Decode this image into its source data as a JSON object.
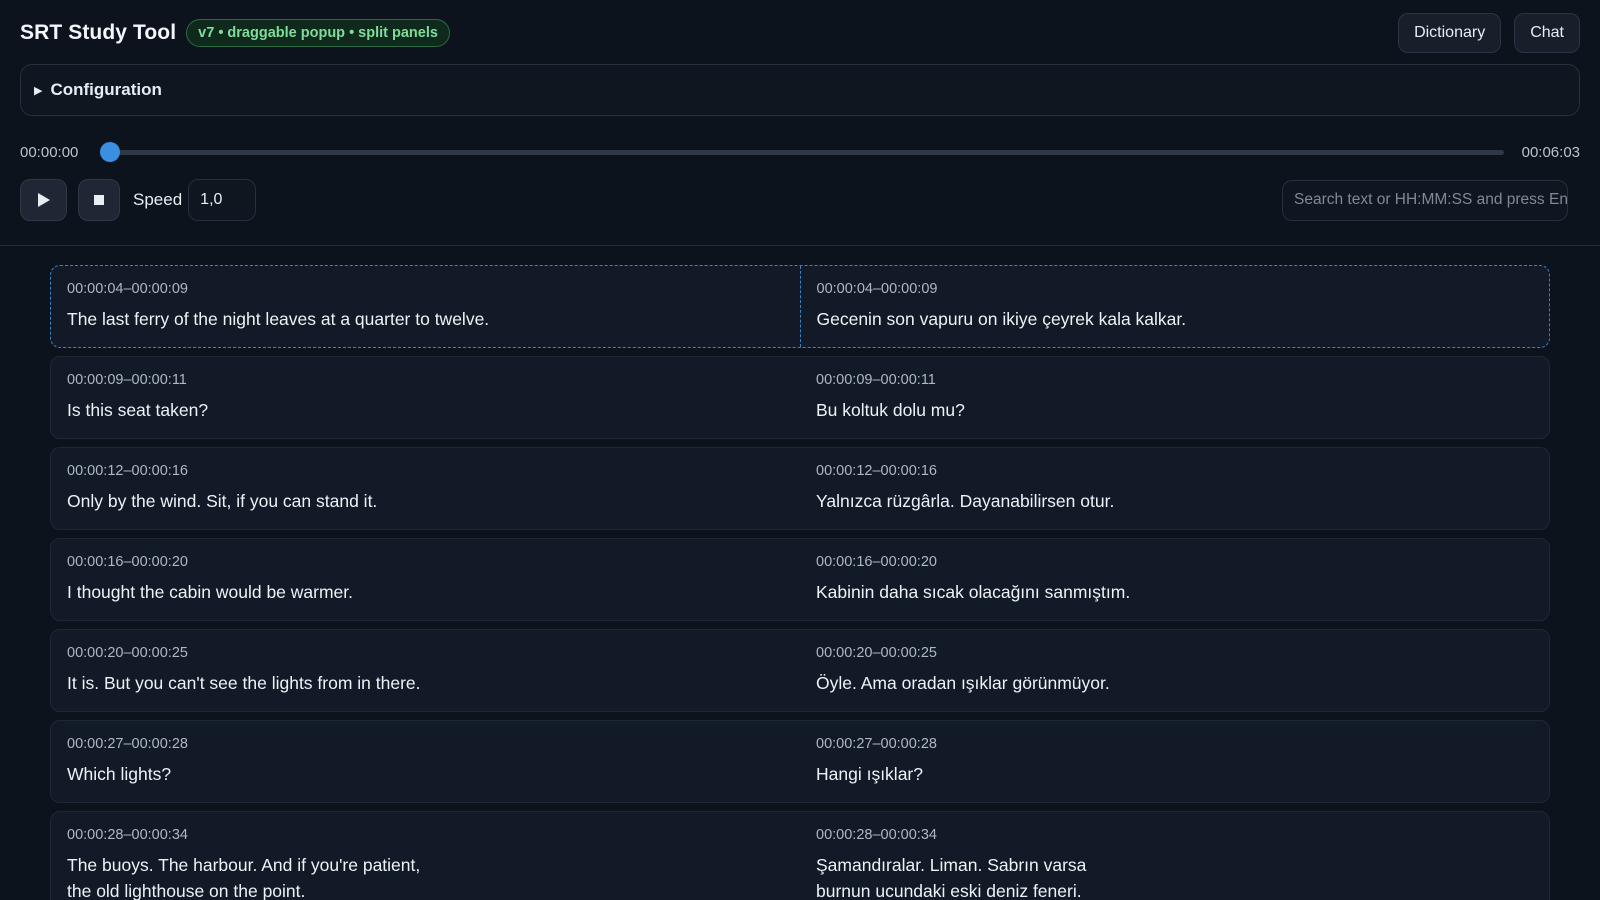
{
  "header": {
    "title": "SRT Study Tool",
    "badge": "v7 • draggable popup • split panels",
    "dictionary_label": "Dictionary",
    "chat_label": "Chat"
  },
  "config": {
    "label": "Configuration",
    "expanded": false
  },
  "timeline": {
    "current": "00:00:00",
    "total": "00:06:03",
    "progress": 0
  },
  "controls": {
    "play_icon": "play-icon",
    "stop_icon": "stop-icon",
    "speed_label": "Speed",
    "speed_value": "1,0",
    "search_placeholder": "Search text or HH:MM:SS and press Enter"
  },
  "colors": {
    "accent": "#3a8fe0",
    "background": "#0d131c",
    "badge_text": "#7fdc9a"
  },
  "cues": [
    {
      "left_time": "00:00:04–00:00:09",
      "left_text": "The last ferry of the night leaves at a quarter to twelve.",
      "right_time": "00:00:04–00:00:09",
      "right_text": "Gecenin son vapuru on ikiye çeyrek kala kalkar."
    },
    {
      "left_time": "00:00:09–00:00:11",
      "left_text": "Is this seat taken?",
      "right_time": "00:00:09–00:00:11",
      "right_text": "Bu koltuk dolu mu?"
    },
    {
      "left_time": "00:00:12–00:00:16",
      "left_text": "Only by the wind. Sit, if you can stand it.",
      "right_time": "00:00:12–00:00:16",
      "right_text": "Yalnızca rüzgârla. Dayanabilirsen otur."
    },
    {
      "left_time": "00:00:16–00:00:20",
      "left_text": "I thought the cabin would be warmer.",
      "right_time": "00:00:16–00:00:20",
      "right_text": "Kabinin daha sıcak olacağını sanmıştım."
    },
    {
      "left_time": "00:00:20–00:00:25",
      "left_text": "It is. But you can't see the lights from in there.",
      "right_time": "00:00:20–00:00:25",
      "right_text": "Öyle. Ama oradan ışıklar görünmüyor."
    },
    {
      "left_time": "00:00:27–00:00:28",
      "left_text": "Which lights?",
      "right_time": "00:00:27–00:00:28",
      "right_text": "Hangi ışıklar?"
    },
    {
      "left_time": "00:00:28–00:00:34",
      "left_text": "The buoys. The harbour. And if you're patient,\nthe old lighthouse on the point.",
      "right_time": "00:00:28–00:00:34",
      "right_text": "Şamandıralar. Liman. Sabrın varsa\nburnun ucundaki eski deniz feneri."
    }
  ],
  "active_cue": 0
}
